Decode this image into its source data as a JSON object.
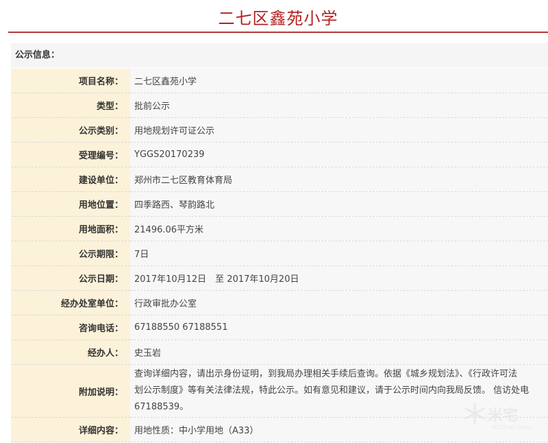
{
  "header": {
    "title": "二七区鑫苑小学"
  },
  "section": {
    "heading": "公示信息："
  },
  "rows": [
    {
      "label": "项目名称：",
      "value": "二七区鑫苑小学"
    },
    {
      "label": "类型：",
      "value": "批前公示"
    },
    {
      "label": "公示类别：",
      "value": "用地规划许可证公示"
    },
    {
      "label": "受理编号：",
      "value": "YGGS20170239"
    },
    {
      "label": "建设单位：",
      "value": "郑州市二七区教育体育局"
    },
    {
      "label": "用地位置：",
      "value": "四季路西、琴韵路北"
    },
    {
      "label": "用地面积：",
      "value": "21496.06平方米"
    },
    {
      "label": "公示期限：",
      "value": "7日"
    },
    {
      "label": "公示日期：",
      "value": "2017年10月12日　至 2017年10月20日"
    },
    {
      "label": "经办处室单位：",
      "value": "行政审批办公室"
    },
    {
      "label": "咨询电话：",
      "value": "67188550 67188551"
    },
    {
      "label": "经办人：",
      "value": "史玉岩"
    }
  ],
  "notes": {
    "label": "附加说明：",
    "lines": [
      "查询详细内容，请出示身份证明，到我局办理相关手续后查询。依据《城乡规划法》、《行政许可法",
      "划公示制度》等有关法律法规，特此公示。如有意见和建议，请于公示时间内向我局反馈。 信访处电",
      "67188539。"
    ]
  },
  "detail": {
    "label": "详细内容：",
    "value": "用地性质：中小学用地（A33）"
  },
  "watermark": {
    "text": "米宅",
    "sub": "mizhai.com"
  }
}
